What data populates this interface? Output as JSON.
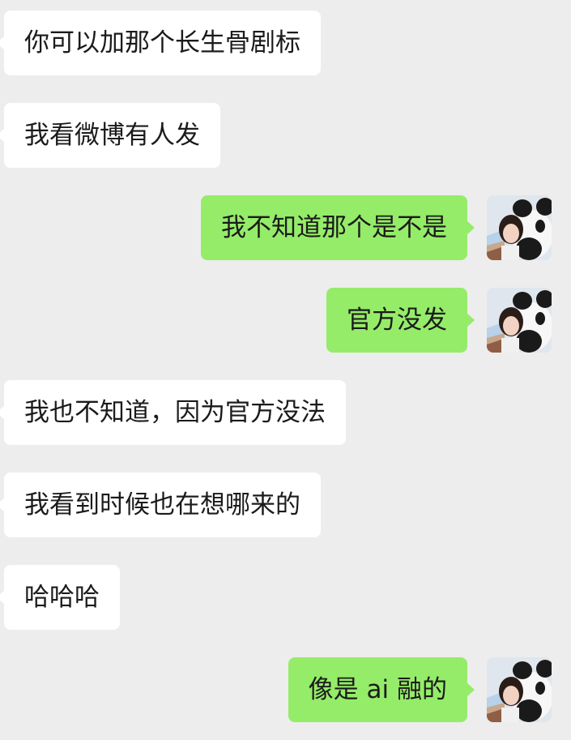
{
  "conversation": {
    "messages": [
      {
        "side": "left",
        "text": "你可以加那个长生骨剧标"
      },
      {
        "side": "left",
        "text": "我看微博有人发"
      },
      {
        "side": "right",
        "text": "我不知道那个是不是",
        "avatar": "user-avatar-panda-girl"
      },
      {
        "side": "right",
        "text": "官方没发",
        "avatar": "user-avatar-panda-girl"
      },
      {
        "side": "left",
        "text": "我也不知道，因为官方没法"
      },
      {
        "side": "left",
        "text": "我看到时候也在想哪来的"
      },
      {
        "side": "left",
        "text": "哈哈哈"
      },
      {
        "side": "right",
        "text": "像是 ai 融的",
        "avatar": "user-avatar-panda-girl"
      }
    ]
  },
  "colors": {
    "background": "#ededed",
    "incoming_bubble": "#ffffff",
    "outgoing_bubble": "#95ec69",
    "text": "#1b1b1b"
  }
}
